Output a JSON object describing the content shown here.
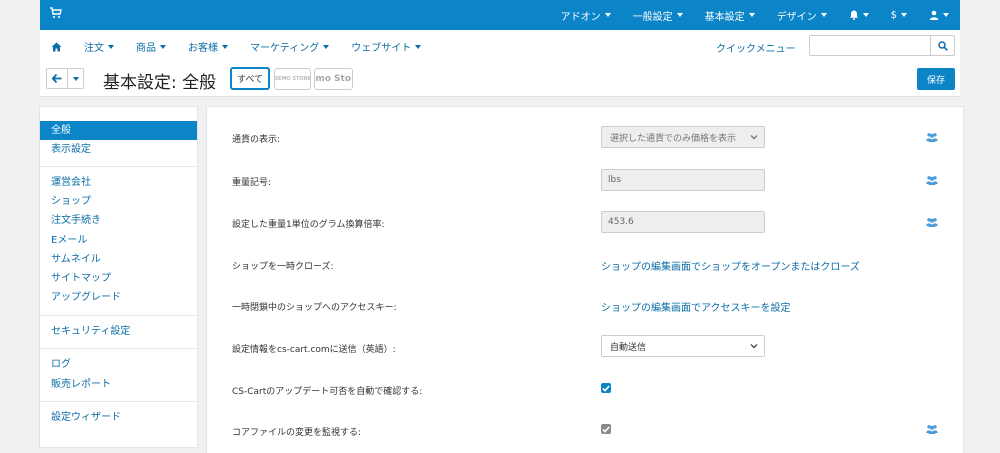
{
  "topnav": {
    "items": [
      "アドオン",
      "一般設定",
      "基本設定",
      "デザイン",
      "",
      "$",
      ""
    ]
  },
  "subnav": {
    "items": [
      "注文",
      "商品",
      "お客様",
      "マーケティング",
      "ウェブサイト"
    ],
    "quick_menu": "クイックメニュー",
    "search_placeholder": ""
  },
  "header": {
    "title": "基本設定: 全般",
    "filter_all": "すべて",
    "filter_store1": "DEMO STORE",
    "filter_store2": "emo Sto",
    "save": "保存"
  },
  "sidebar": {
    "items": [
      "全般",
      "表示設定",
      "運営会社",
      "ショップ",
      "注文手続き",
      "Eメール",
      "サムネイル",
      "サイトマップ",
      "アップグレード",
      "セキュリティ設定",
      "ログ",
      "販売レポート",
      "設定ウィザード"
    ]
  },
  "settings": [
    {
      "label": "通貨の表示:",
      "value": "選択した通貨でのみ価格を表示"
    },
    {
      "label": "重量記号:",
      "value": "lbs"
    },
    {
      "label": "設定した重量1単位のグラム換算倍率:",
      "value": "453.6"
    },
    {
      "label": "ショップを一時クローズ:",
      "value": "ショップの編集画面でショップをオープンまたはクローズ"
    },
    {
      "label": "一時閉鎖中のショップへのアクセスキー:",
      "value": "ショップの編集画面でアクセスキーを設定"
    },
    {
      "label": "設定情報をcs-cart.comに送信（英語）:",
      "value": "自動送信"
    },
    {
      "label": "CS-Cartのアップデート可否を自動で確認する:",
      "checked": true
    },
    {
      "label": "コアファイルの変更を監視する:",
      "checked": true
    }
  ],
  "colors": {
    "brand": "#0b84c8",
    "link": "#0b6da8",
    "checkbox_enabled": "#0b84c8",
    "checkbox_disabled": "#8a8a8a",
    "user_icon": "#4a9bd8"
  },
  "icons": {
    "cart": "cart-icon",
    "bell": "bell-icon",
    "user": "user-icon",
    "home": "home-icon",
    "search": "search-icon",
    "back": "arrow-left-icon",
    "settings_shared": "users-icon"
  }
}
